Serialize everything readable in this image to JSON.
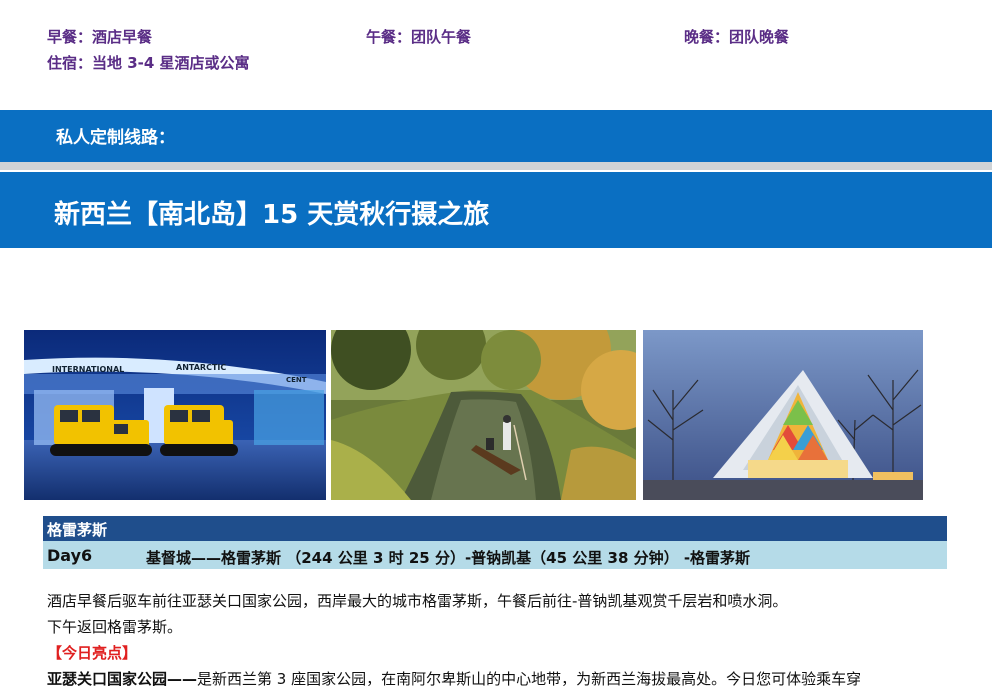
{
  "meals": {
    "breakfast": "早餐：酒店早餐",
    "lunch": "午餐：团队午餐",
    "dinner": "晚餐：团队晚餐",
    "lodging": "住宿：当地 3-4 星酒店或公寓"
  },
  "banner": {
    "label": "私人定制线路：",
    "title": "新西兰【南北岛】15 天赏秋行摄之旅"
  },
  "photos": {
    "photo1_sign_left": "INTERNATIONAL",
    "photo1_sign_right": "ANTARCTIC",
    "photo1_sign_edge": "CENT"
  },
  "itinerary": {
    "location": "格雷茅斯",
    "day": "Day6",
    "route": "基督城——格雷茅斯 （244 公里 3 时 25 分）-普钠凯基（45 公里 38 分钟） -格雷茅斯",
    "para1": "酒店早餐后驱车前往亚瑟关口国家公园，西岸最大的城市格雷茅斯，午餐后前往-普钠凯基观赏千层岩和喷水洞。",
    "para2": "下午返回格雷茅斯。",
    "highlight_label": "【今日亮点】",
    "highlight_name": "亚瑟关口国家公园——",
    "highlight_text": "是新西兰第 3 座国家公园，在南阿尔卑斯山的中心地带，为新西兰海拔最高处。今日您可体验乘车穿"
  }
}
